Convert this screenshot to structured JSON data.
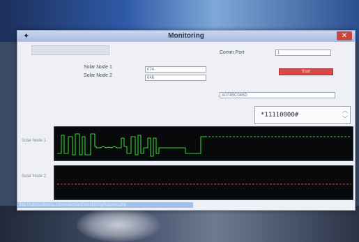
{
  "window": {
    "title": "Monitoring",
    "app_icon": "app-icon",
    "close_icon": "close-icon"
  },
  "comm_port": {
    "label": "Comm Port",
    "value": "1"
  },
  "solar_node_1": {
    "label": "Solar Node 1",
    "value": "074"
  },
  "solar_node_2": {
    "label": "Solar Node 2",
    "value": "046"
  },
  "start_button": {
    "label": "Start",
    "color": "#d84a4a"
  },
  "combined_readout": "A074BC046D",
  "command": {
    "value": "*11110000#"
  },
  "plots": [
    {
      "label": "Solar Node 1",
      "line_color": "#36d136"
    },
    {
      "label": "Solar Node 2",
      "line_color": "#e04545"
    }
  ],
  "status_link": "http://iotcloudiotera.com/solarplant/monitoring/logview.php"
}
